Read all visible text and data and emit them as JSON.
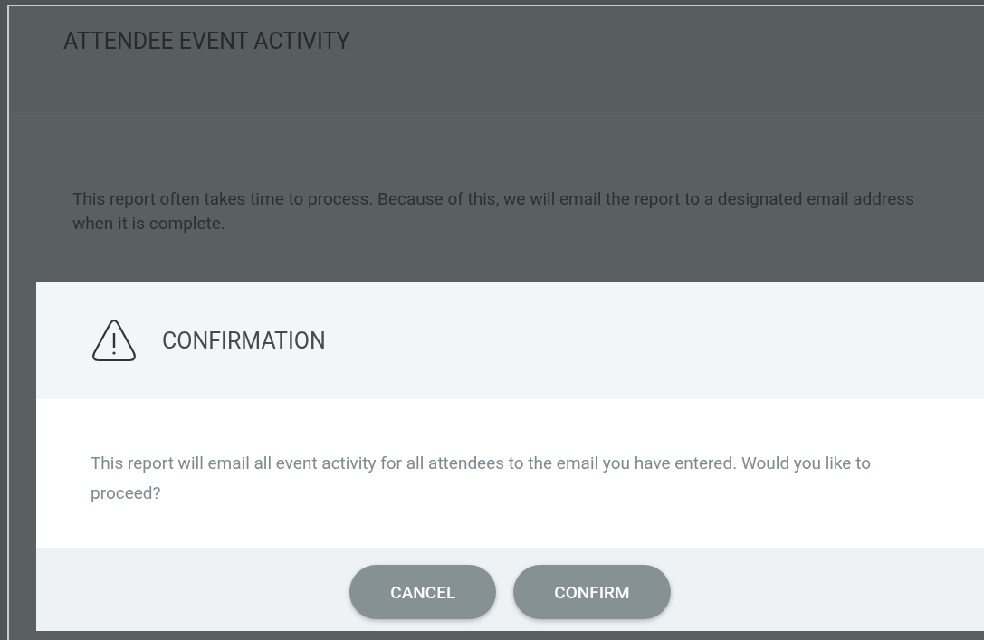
{
  "page": {
    "title": "ATTENDEE EVENT ACTIVITY",
    "description": "This report often takes time to process. Because of this, we will email the report to a designated email address when it is complete."
  },
  "dialog": {
    "title": "CONFIRMATION",
    "message": "This report will email all event activity for all attendees to the email you have entered. Would you like to proceed?",
    "buttons": [
      {
        "label": "CANCEL"
      },
      {
        "label": "CONFIRM"
      }
    ]
  }
}
